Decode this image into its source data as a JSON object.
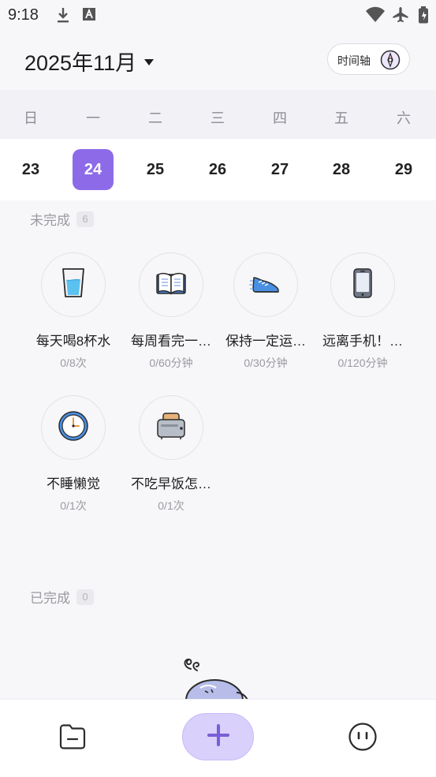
{
  "status_bar": {
    "time": "9:18",
    "icons": [
      "download-icon",
      "keyboard-a-icon",
      "wifi-icon",
      "airplane-icon",
      "battery-icon"
    ]
  },
  "header": {
    "month": "2025年11月",
    "timeline_label": "时间轴"
  },
  "week": {
    "weekdays": [
      "日",
      "一",
      "二",
      "三",
      "四",
      "五",
      "六"
    ],
    "dates": [
      "23",
      "24",
      "25",
      "26",
      "27",
      "28",
      "29"
    ],
    "selected_index": 1
  },
  "incomplete": {
    "label": "未完成",
    "count": "6",
    "habits": [
      {
        "name": "每天喝8杯水",
        "progress": "0/8次",
        "icon": "water-glass-icon"
      },
      {
        "name": "每周看完一…",
        "progress": "0/60分钟",
        "icon": "open-book-icon"
      },
      {
        "name": "保持一定运…",
        "progress": "0/30分钟",
        "icon": "running-shoe-icon"
      },
      {
        "name": "远离手机！…",
        "progress": "0/120分钟",
        "icon": "smartphone-icon"
      },
      {
        "name": "不睡懒觉",
        "progress": "0/1次",
        "icon": "clock-icon"
      },
      {
        "name": "不吃早饭怎…",
        "progress": "0/1次",
        "icon": "toaster-icon"
      }
    ]
  },
  "completed": {
    "label": "已完成",
    "count": "0"
  },
  "bottom_nav": {
    "items": [
      "folder-icon",
      "add-icon",
      "smiley-icon"
    ]
  },
  "colors": {
    "accent": "#8d6be8",
    "add_button": "#d9d0fb",
    "muted_text": "#9a9aa0"
  }
}
